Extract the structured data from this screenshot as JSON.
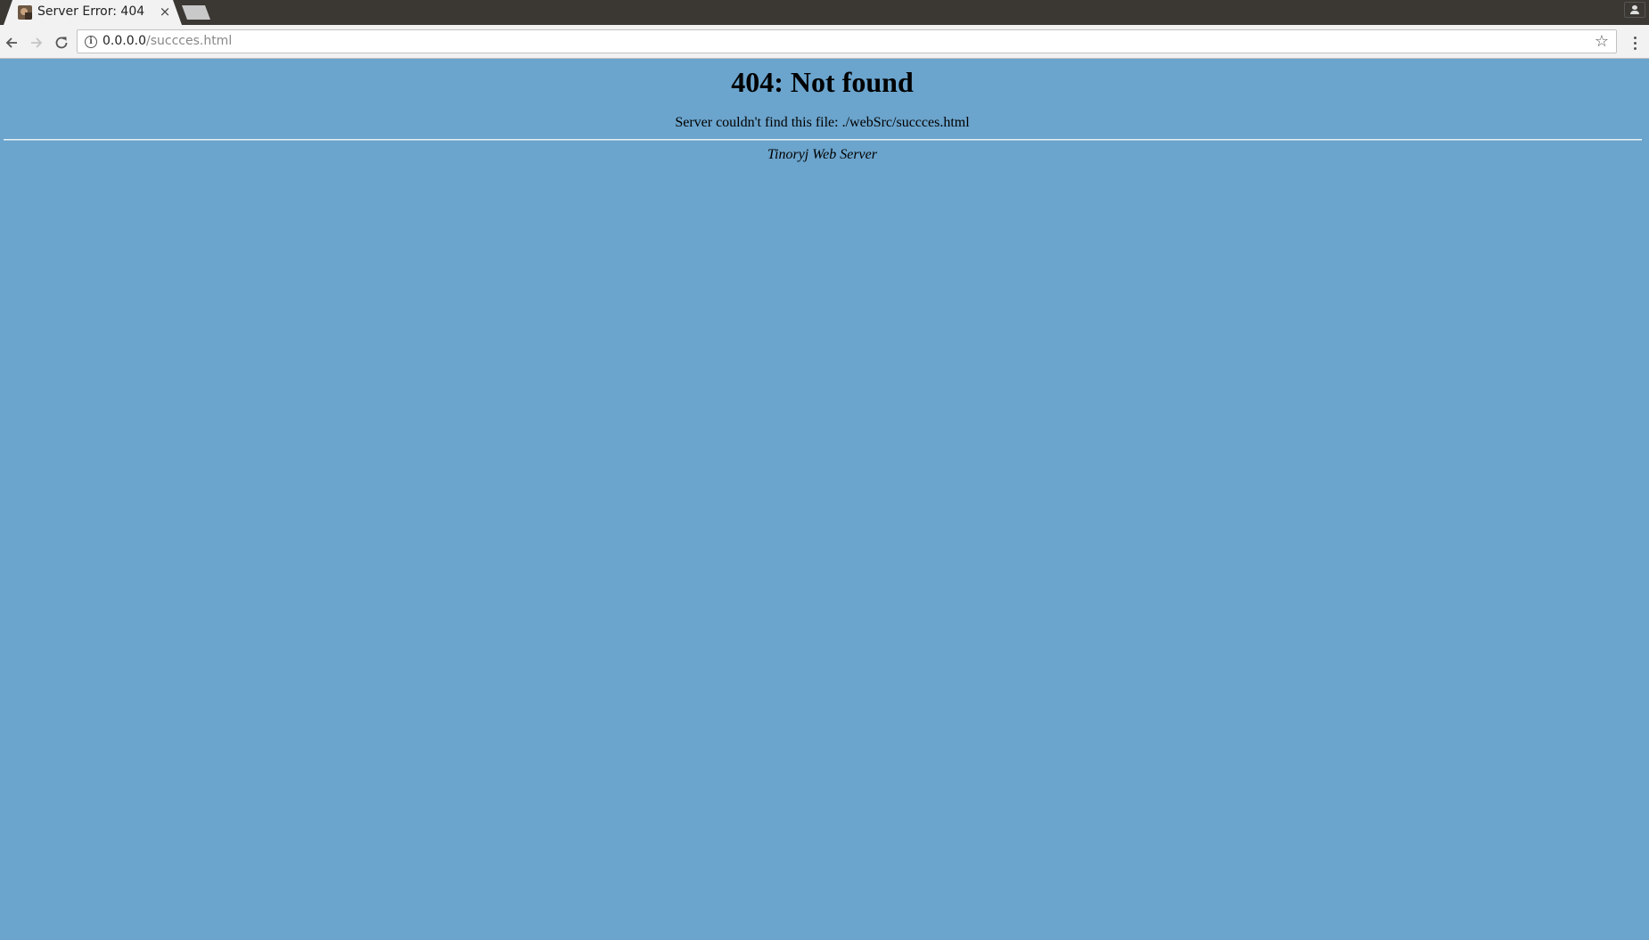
{
  "browser": {
    "tab": {
      "title": "Server Error: 404",
      "close_glyph": "×",
      "favicon": "site-favicon"
    },
    "address_bar": {
      "host": "0.0.0.0",
      "path": "/succces.html",
      "security_icon": "info-icon",
      "bookmark_icon": "star-icon"
    },
    "icons": {
      "back": "back-arrow-icon",
      "forward": "forward-arrow-icon",
      "reload": "reload-icon",
      "menu": "kebab-menu-icon",
      "profile": "profile-icon"
    }
  },
  "page": {
    "background_color": "#6ba4cc",
    "heading": "404: Not found",
    "message": "Server couldn't find this file: ./webSrc/succces.html",
    "footer": "Tinoryj Web Server"
  }
}
